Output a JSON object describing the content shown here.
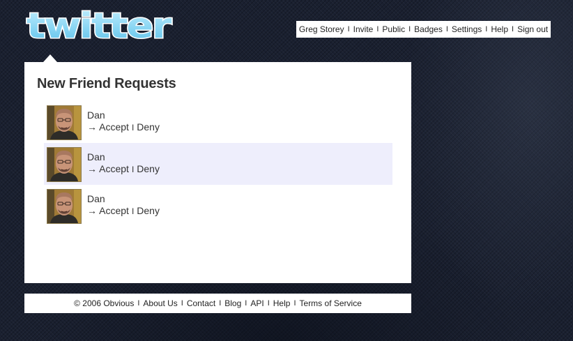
{
  "header": {
    "logo_text": "twitter",
    "nav": [
      {
        "label": "Greg Storey"
      },
      {
        "label": "Invite"
      },
      {
        "label": "Public"
      },
      {
        "label": "Badges"
      },
      {
        "label": "Settings"
      },
      {
        "label": "Help"
      },
      {
        "label": "Sign out"
      }
    ],
    "nav_separator": "I"
  },
  "main": {
    "title": "New Friend Requests",
    "requests": [
      {
        "name": "Dan",
        "arrow": "→",
        "accept_label": "Accept",
        "separator": "I",
        "deny_label": "Deny",
        "highlighted": false
      },
      {
        "name": "Dan",
        "arrow": "→",
        "accept_label": "Accept",
        "separator": "I",
        "deny_label": "Deny",
        "highlighted": true
      },
      {
        "name": "Dan",
        "arrow": "→",
        "accept_label": "Accept",
        "separator": "I",
        "deny_label": "Deny",
        "highlighted": false
      }
    ]
  },
  "footer": {
    "copyright": "© 2006 Obvious",
    "links": [
      {
        "label": "About Us"
      },
      {
        "label": "Contact"
      },
      {
        "label": "Blog"
      },
      {
        "label": "API"
      },
      {
        "label": "Help"
      },
      {
        "label": "Terms of Service"
      }
    ],
    "separator": "I"
  },
  "colors": {
    "background": "#1a2030",
    "panel": "#ffffff",
    "highlight_row": "#eeeefc",
    "logo_fill": "#8fd8f4",
    "logo_outline": "#ffffff"
  },
  "icons": {
    "logo": "twitter-logo",
    "arrow": "right-arrow-icon"
  }
}
